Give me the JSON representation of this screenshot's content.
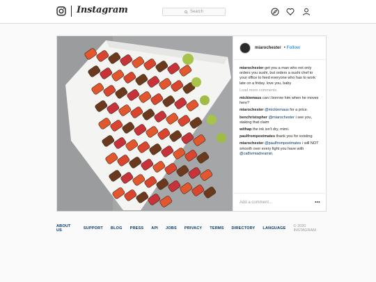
{
  "nav": {
    "wordmark": "Instagram",
    "search_placeholder": "Search",
    "icons": [
      "instagram-logo-icon",
      "compass-icon",
      "heart-icon",
      "profile-icon"
    ]
  },
  "post": {
    "username": "miarochester",
    "separator": "•",
    "follow_label": "Follow",
    "caption_user": "miarochester",
    "caption": " get you a man who not only orders you sushi, but orders a sushi chef to your office to feed everyone who has to work late on a friday. love you, baby",
    "load_more": "Load more comments",
    "comments": [
      {
        "user": "mickiemaus",
        "text": " can i borrow him when he moves here?"
      },
      {
        "user": "miarochester",
        "mention": " @mickiemaus",
        "text": " for a price."
      },
      {
        "user": "benchristopher",
        "mention": " @miarochester",
        "text": " i see you, staking that claim"
      },
      {
        "user": "withap",
        "text": " the ink isn't dry, mimi."
      },
      {
        "user": "paulfrompostmates",
        "text": " thank you for existing"
      },
      {
        "user": "miarochester",
        "mention": " @paulfrompostmates",
        "text": " i will NOT smooth over every fight you have with ",
        "mention2": "@ca8ivmiadreamin",
        "text2": "."
      }
    ],
    "add_comment_placeholder": "Add a comment...",
    "more_options": "•••"
  },
  "footer": {
    "links": [
      "ABOUT US",
      "SUPPORT",
      "BLOG",
      "PRESS",
      "API",
      "JOBS",
      "PRIVACY",
      "TERMS",
      "DIRECTORY",
      "LANGUAGE"
    ],
    "copyright": "© 2020 INSTAGRAM"
  },
  "colors": {
    "link_blue": "#3897f0",
    "mention_navy": "#003569",
    "border": "#dbdbdb",
    "background": "#fafafa"
  }
}
